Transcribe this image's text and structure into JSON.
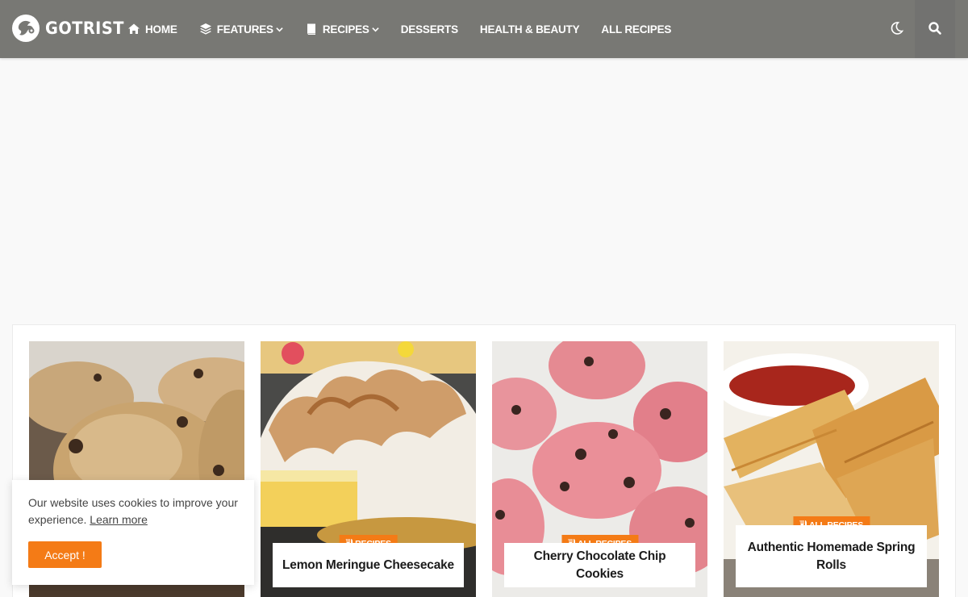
{
  "site": {
    "logo_text": "GOTRIST"
  },
  "nav": {
    "home": "HOME",
    "features": "FEATURES",
    "recipes": "RECIPES",
    "desserts": "DESSERTS",
    "health": "HEALTH & BEAUTY",
    "all": "ALL RECIPES"
  },
  "colors": {
    "header": "#787874",
    "accent": "#f47b16"
  },
  "cards": [
    {
      "title": "",
      "category": ""
    },
    {
      "title": "Lemon Meringue Cheesecake",
      "category": "RECIPES"
    },
    {
      "title": "Cherry Chocolate Chip Cookies",
      "category": "ALL RECIPES"
    },
    {
      "title": "Authentic Homemade Spring Rolls",
      "category": "ALL RECIPES"
    }
  ],
  "cookie": {
    "message": "Our website uses cookies to improve your experience.",
    "learn_more": "Learn more",
    "accept": "Accept !"
  }
}
